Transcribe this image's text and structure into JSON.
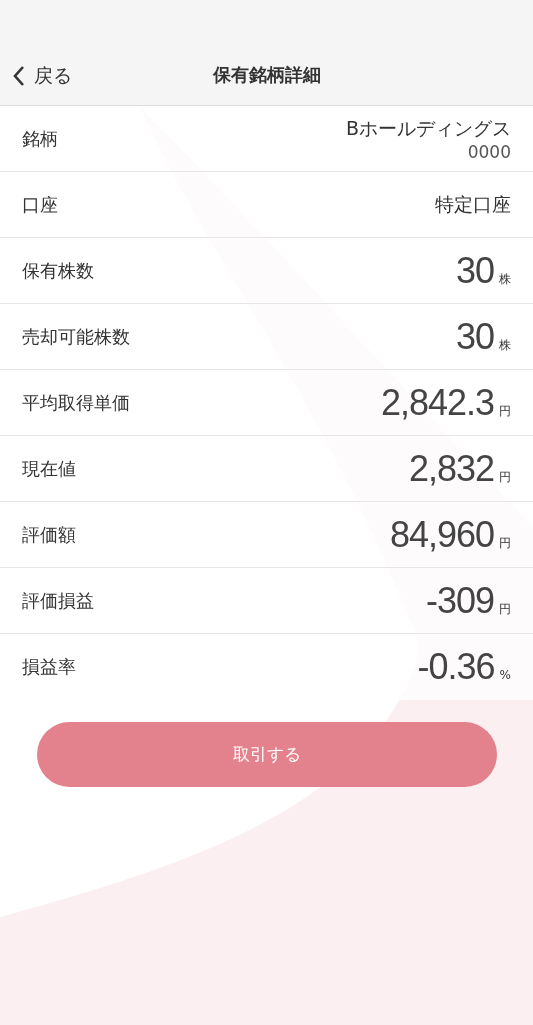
{
  "header": {
    "back_label": "戻る",
    "title": "保有銘柄詳細"
  },
  "rows": [
    {
      "kind": "text",
      "label": "銘柄",
      "value": "Bホールディングス",
      "sub": "0000"
    },
    {
      "kind": "text",
      "label": "口座",
      "value": "特定口座"
    },
    {
      "kind": "number",
      "label": "保有株数",
      "value": "30",
      "unit": "株"
    },
    {
      "kind": "number",
      "label": "売却可能株数",
      "value": "30",
      "unit": "株"
    },
    {
      "kind": "number",
      "label": "平均取得単価",
      "value": "2,842.3",
      "unit": "円"
    },
    {
      "kind": "number",
      "label": "現在値",
      "value": "2,832",
      "unit": "円"
    },
    {
      "kind": "number",
      "label": "評価額",
      "value": "84,960",
      "unit": "円"
    },
    {
      "kind": "number",
      "label": "評価損益",
      "value": "-309",
      "unit": "円"
    },
    {
      "kind": "number",
      "label": "損益率",
      "value": "-0.36",
      "unit": "%"
    }
  ],
  "trade_button": "取引する"
}
